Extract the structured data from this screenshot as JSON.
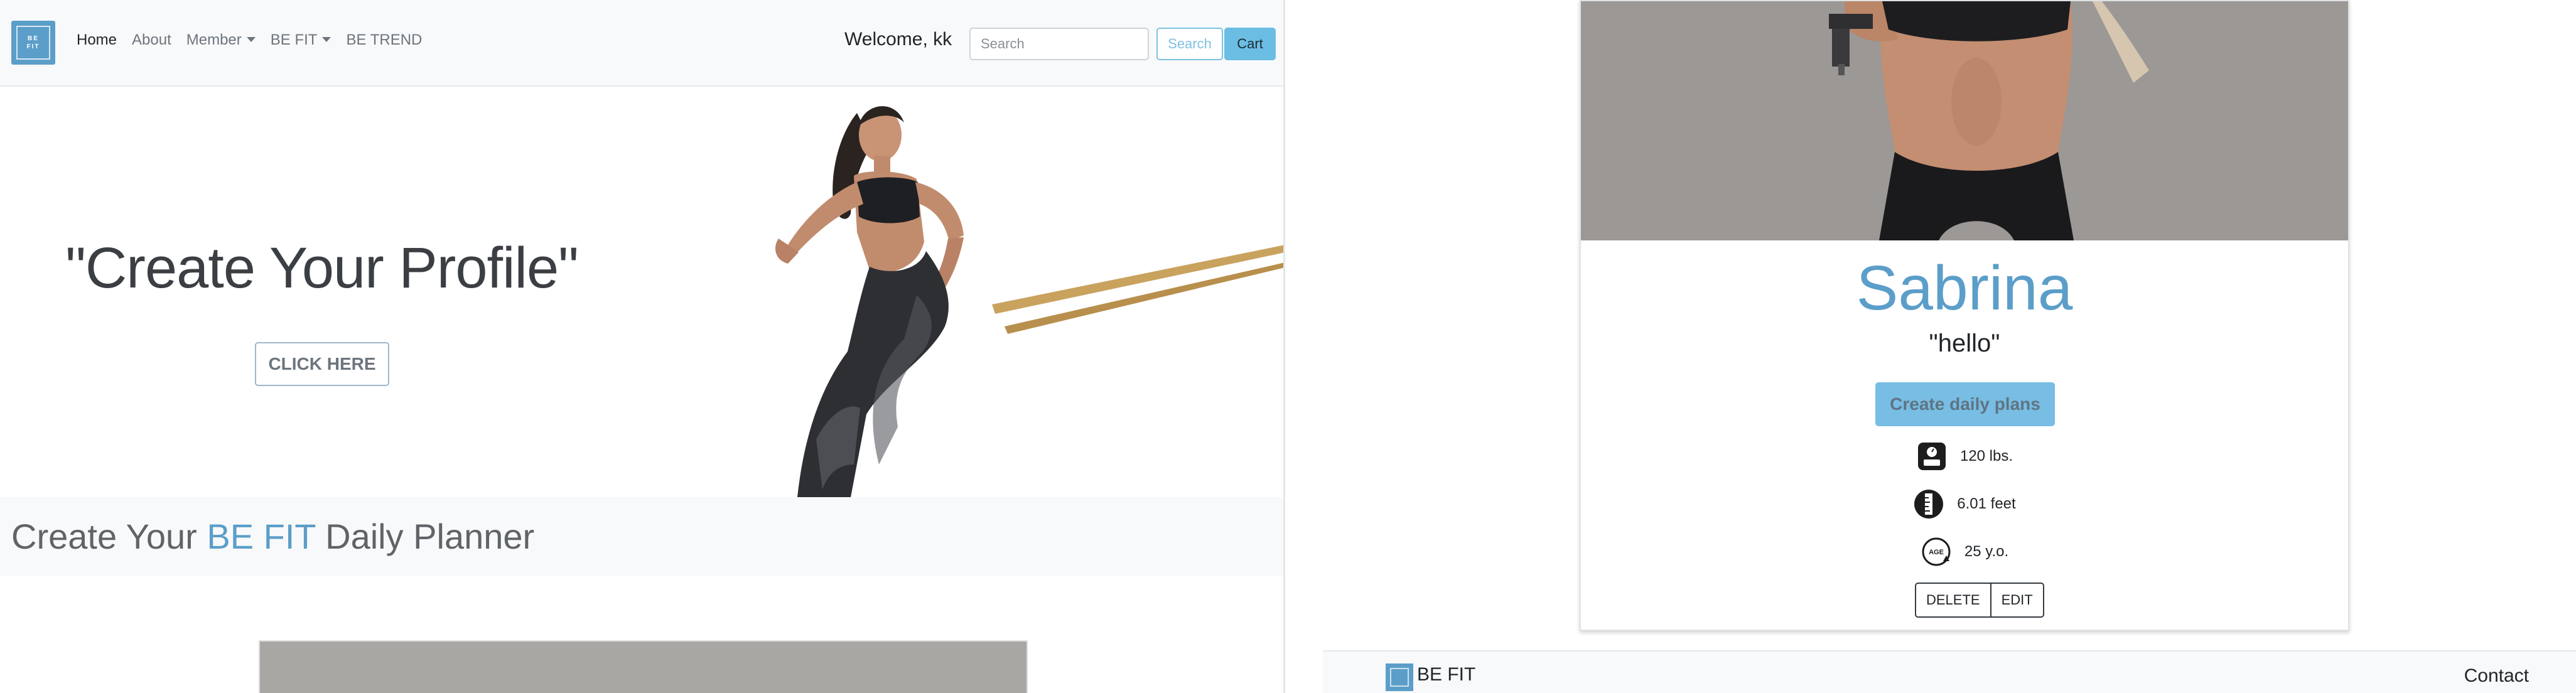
{
  "left": {
    "nav": {
      "logo_text_top": "BE",
      "logo_text_bottom": "FIT",
      "links": {
        "home": "Home",
        "about": "About",
        "member": "Member",
        "befit": "BE FIT",
        "betrend": "BE TREND"
      },
      "welcome": "Welcome, kk",
      "search_placeholder": "Search",
      "search_button": "Search",
      "cart_button": "Cart"
    },
    "hero": {
      "title": "\"Create Your Profile\"",
      "button": "CLICK HERE"
    },
    "planner": {
      "title_pre": "Create Your ",
      "title_accent": "BE FIT",
      "title_post": " Daily Planner"
    }
  },
  "right": {
    "profile": {
      "name": "Sabrina",
      "quote": "\"hello\"",
      "plans_button": "Create daily plans",
      "weight": "120 lbs.",
      "height": "6.01 feet",
      "age_icon_label": "AGE",
      "age": "25 y.o.",
      "delete_button": "DELETE",
      "edit_button": "EDIT"
    },
    "footer": {
      "brand": "BE FIT",
      "contact": "Contact"
    }
  },
  "colors": {
    "brand": "#5b9ec9",
    "accent_button": "#78bde3",
    "navbar_bg": "#f8f9fa"
  },
  "icons": [
    "logo-icon",
    "caret-down-icon",
    "scale-icon",
    "ruler-icon",
    "age-icon"
  ]
}
